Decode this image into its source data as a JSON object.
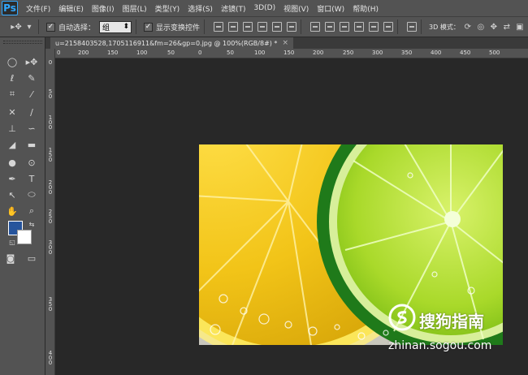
{
  "app": {
    "logo": "Ps"
  },
  "menu": [
    "文件(F)",
    "编辑(E)",
    "图像(I)",
    "图层(L)",
    "类型(Y)",
    "选择(S)",
    "滤镜(T)",
    "3D(D)",
    "视图(V)",
    "窗口(W)",
    "帮助(H)"
  ],
  "options": {
    "auto_select_label": "自动选择：",
    "auto_select_checked": true,
    "auto_select_value": "组",
    "show_transform_label": "显示变换控件",
    "show_transform_checked": true,
    "mode_3d_label": "3D 模式："
  },
  "document_tab": {
    "title": "u=2158403528,1705116911&fm=26&gp=0.jpg @ 100%(RGB/8#) *",
    "close": "×"
  },
  "ruler_top_labels": [
    "0",
    "200",
    "150",
    "100",
    "50",
    "0",
    "50",
    "100",
    "150",
    "200",
    "250",
    "300",
    "350",
    "400",
    "450",
    "500"
  ],
  "ruler_left_labels": [
    "0",
    "5 0",
    "1 0 0",
    "1 5 0",
    "2 0 0",
    "2 5 0",
    "3 0 0",
    "3 5 0",
    "4 0 0"
  ],
  "colors": {
    "foreground": "#26549c",
    "background": "#ffffff",
    "accent": "#31a8ff"
  },
  "watermark": {
    "brand": "搜狗指南",
    "url": "zhinan.sogou.com"
  },
  "tools": [
    "move-icon",
    "marquee-icon",
    "lasso-icon",
    "quick-select-icon",
    "crop-icon",
    "eyedropper-icon",
    "healing-icon",
    "brush-icon",
    "stamp-icon",
    "history-brush-icon",
    "eraser-icon",
    "gradient-icon",
    "blur-icon",
    "dodge-icon",
    "pen-icon",
    "type-icon",
    "path-select-icon",
    "shape-icon",
    "hand-icon",
    "zoom-icon"
  ]
}
